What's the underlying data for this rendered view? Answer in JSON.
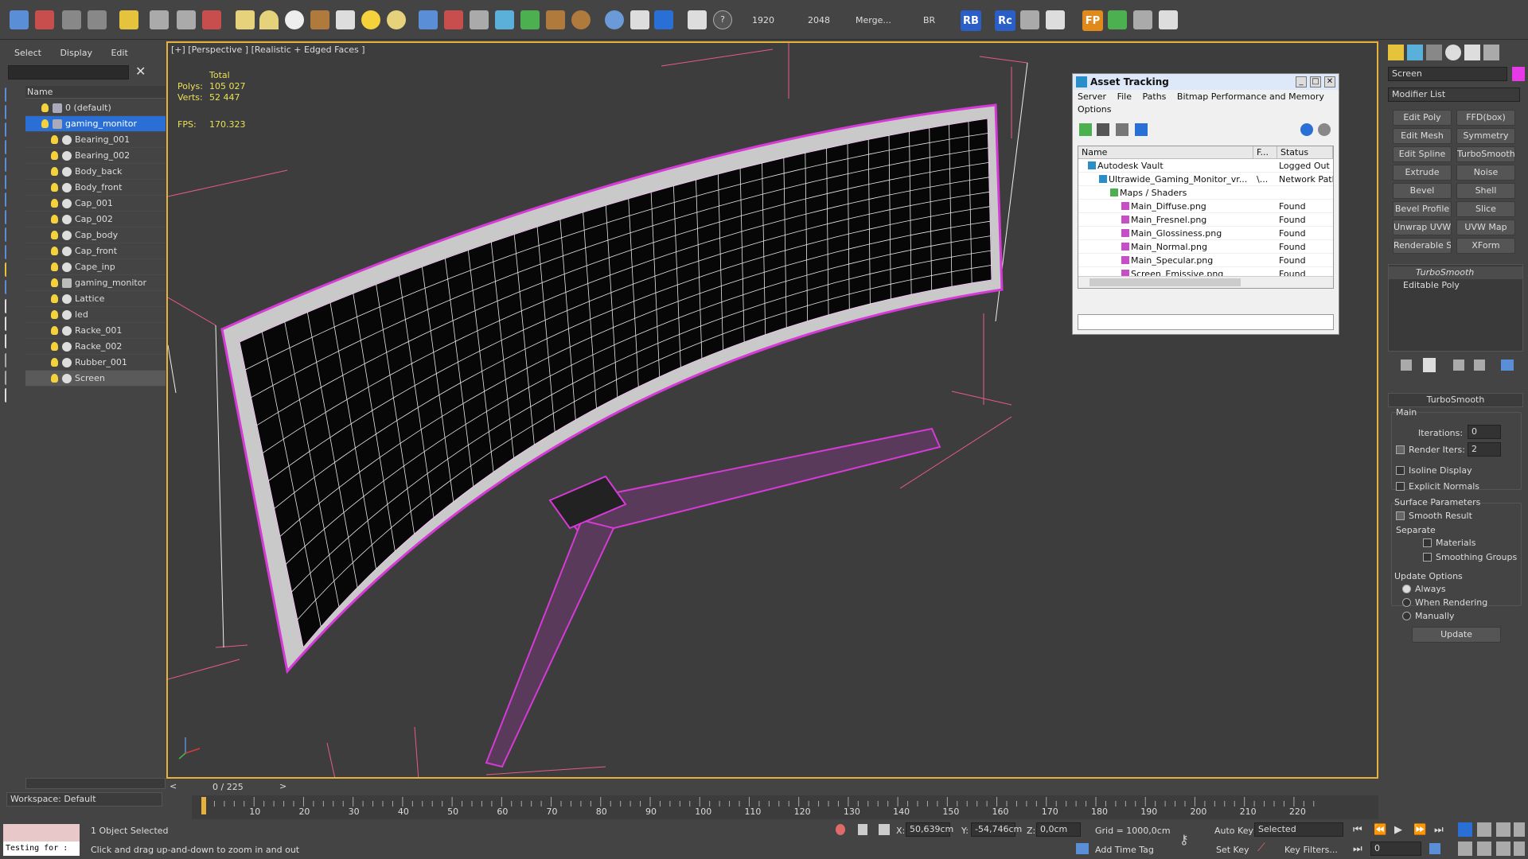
{
  "toolbar": {
    "res_w": "1920",
    "res_h": "2048",
    "merge": "Merge...",
    "br": "BR",
    "rb": "RB",
    "rc": "Rc",
    "fp": "FP"
  },
  "scene_explorer": {
    "menu": [
      "Select",
      "Display",
      "Edit"
    ],
    "column_name": "Name",
    "items": [
      {
        "name": "0 (default)",
        "indent": 0,
        "type": "layer",
        "state": ""
      },
      {
        "name": "gaming_monitor",
        "indent": 0,
        "type": "layer",
        "state": "selected"
      },
      {
        "name": "Bearing_001",
        "indent": 1,
        "type": "obj",
        "state": ""
      },
      {
        "name": "Bearing_002",
        "indent": 1,
        "type": "obj",
        "state": ""
      },
      {
        "name": "Body_back",
        "indent": 1,
        "type": "obj",
        "state": ""
      },
      {
        "name": "Body_front",
        "indent": 1,
        "type": "obj",
        "state": ""
      },
      {
        "name": "Cap_001",
        "indent": 1,
        "type": "obj",
        "state": ""
      },
      {
        "name": "Cap_002",
        "indent": 1,
        "type": "obj",
        "state": ""
      },
      {
        "name": "Cap_body",
        "indent": 1,
        "type": "obj",
        "state": ""
      },
      {
        "name": "Cap_front",
        "indent": 1,
        "type": "obj",
        "state": ""
      },
      {
        "name": "Cape_inp",
        "indent": 1,
        "type": "obj",
        "state": ""
      },
      {
        "name": "gaming_monitor",
        "indent": 1,
        "type": "group",
        "state": ""
      },
      {
        "name": "Lattice",
        "indent": 1,
        "type": "obj",
        "state": ""
      },
      {
        "name": "led",
        "indent": 1,
        "type": "obj",
        "state": ""
      },
      {
        "name": "Racke_001",
        "indent": 1,
        "type": "obj",
        "state": ""
      },
      {
        "name": "Racke_002",
        "indent": 1,
        "type": "obj",
        "state": ""
      },
      {
        "name": "Rubber_001",
        "indent": 1,
        "type": "obj",
        "state": ""
      },
      {
        "name": "Screen",
        "indent": 1,
        "type": "obj",
        "state": "highlight"
      }
    ],
    "workspace": "Workspace: Default"
  },
  "viewport": {
    "label": "[+] [Perspective ] [Realistic + Edged Faces ]",
    "stats": {
      "total_label": "Total",
      "polys_label": "Polys:",
      "polys": "105 027",
      "verts_label": "Verts:",
      "verts": "52 447",
      "fps_label": "FPS:",
      "fps": "170.323"
    }
  },
  "asset_tracking": {
    "title": "Asset Tracking",
    "menu": [
      "Server",
      "File",
      "Paths",
      "Bitmap Performance and Memory"
    ],
    "menu2": "Options",
    "columns": [
      "Name",
      "F...",
      "Status"
    ],
    "rows": [
      {
        "name": "Autodesk Vault",
        "f": "",
        "status": "Logged Out (...",
        "indent": 1
      },
      {
        "name": "Ultrawide_Gaming_Monitor_vr...",
        "f": "\\...",
        "status": "Network Path",
        "indent": 2
      },
      {
        "name": "Maps / Shaders",
        "f": "",
        "status": "",
        "indent": 3
      },
      {
        "name": "Main_Diffuse.png",
        "f": "",
        "status": "Found",
        "indent": 4
      },
      {
        "name": "Main_Fresnel.png",
        "f": "",
        "status": "Found",
        "indent": 4
      },
      {
        "name": "Main_Glossiness.png",
        "f": "",
        "status": "Found",
        "indent": 4
      },
      {
        "name": "Main_Normal.png",
        "f": "",
        "status": "Found",
        "indent": 4
      },
      {
        "name": "Main_Specular.png",
        "f": "",
        "status": "Found",
        "indent": 4
      },
      {
        "name": "Screen_Emissive.png",
        "f": "",
        "status": "Found",
        "indent": 4
      }
    ]
  },
  "command_panel": {
    "object_name": "Screen",
    "modifier_list": "Modifier List",
    "buttons": [
      "Edit Poly",
      "FFD(box)",
      "Edit Mesh",
      "Symmetry",
      "Edit Spline",
      "TurboSmooth",
      "Extrude",
      "Noise",
      "Bevel",
      "Shell",
      "Bevel Profile",
      "Slice",
      "Unwrap UVW",
      "UVW Map",
      "Renderable Spline",
      "XForm"
    ],
    "stack": [
      "TurboSmooth",
      "Editable Poly"
    ],
    "rollout_title": "TurboSmooth",
    "main_label": "Main",
    "iterations_label": "Iterations:",
    "iterations": "0",
    "render_iters_label": "Render Iters:",
    "render_iters": "2",
    "isoline": "Isoline Display",
    "explicit": "Explicit Normals",
    "surface_params": "Surface Parameters",
    "smooth_result": "Smooth Result",
    "separate": "Separate",
    "materials": "Materials",
    "smoothing_groups": "Smoothing Groups",
    "update_options": "Update Options",
    "always": "Always",
    "when_rendering": "When Rendering",
    "manually": "Manually",
    "update_btn": "Update"
  },
  "timeline": {
    "frame": "0 / 225",
    "ticks": [
      "10",
      "20",
      "30",
      "40",
      "50",
      "60",
      "70",
      "80",
      "90",
      "100",
      "110",
      "120",
      "130",
      "140",
      "150",
      "160",
      "170",
      "180",
      "190",
      "200",
      "210",
      "220"
    ]
  },
  "status_bar": {
    "maxscript": "Testing for :",
    "selected": "1 Object Selected",
    "prompt": "Click and drag up-and-down to zoom in and out",
    "x_label": "X:",
    "x": "50,639cm",
    "y_label": "Y:",
    "y": "-54,746cm",
    "z_label": "Z:",
    "z": "0,0cm",
    "grid": "Grid = 1000,0cm",
    "add_time_tag": "Add Time Tag",
    "auto_key": "Auto Key",
    "selected_dd": "Selected",
    "set_key": "Set Key",
    "key_filters": "Key Filters...",
    "frame_field": "0"
  }
}
